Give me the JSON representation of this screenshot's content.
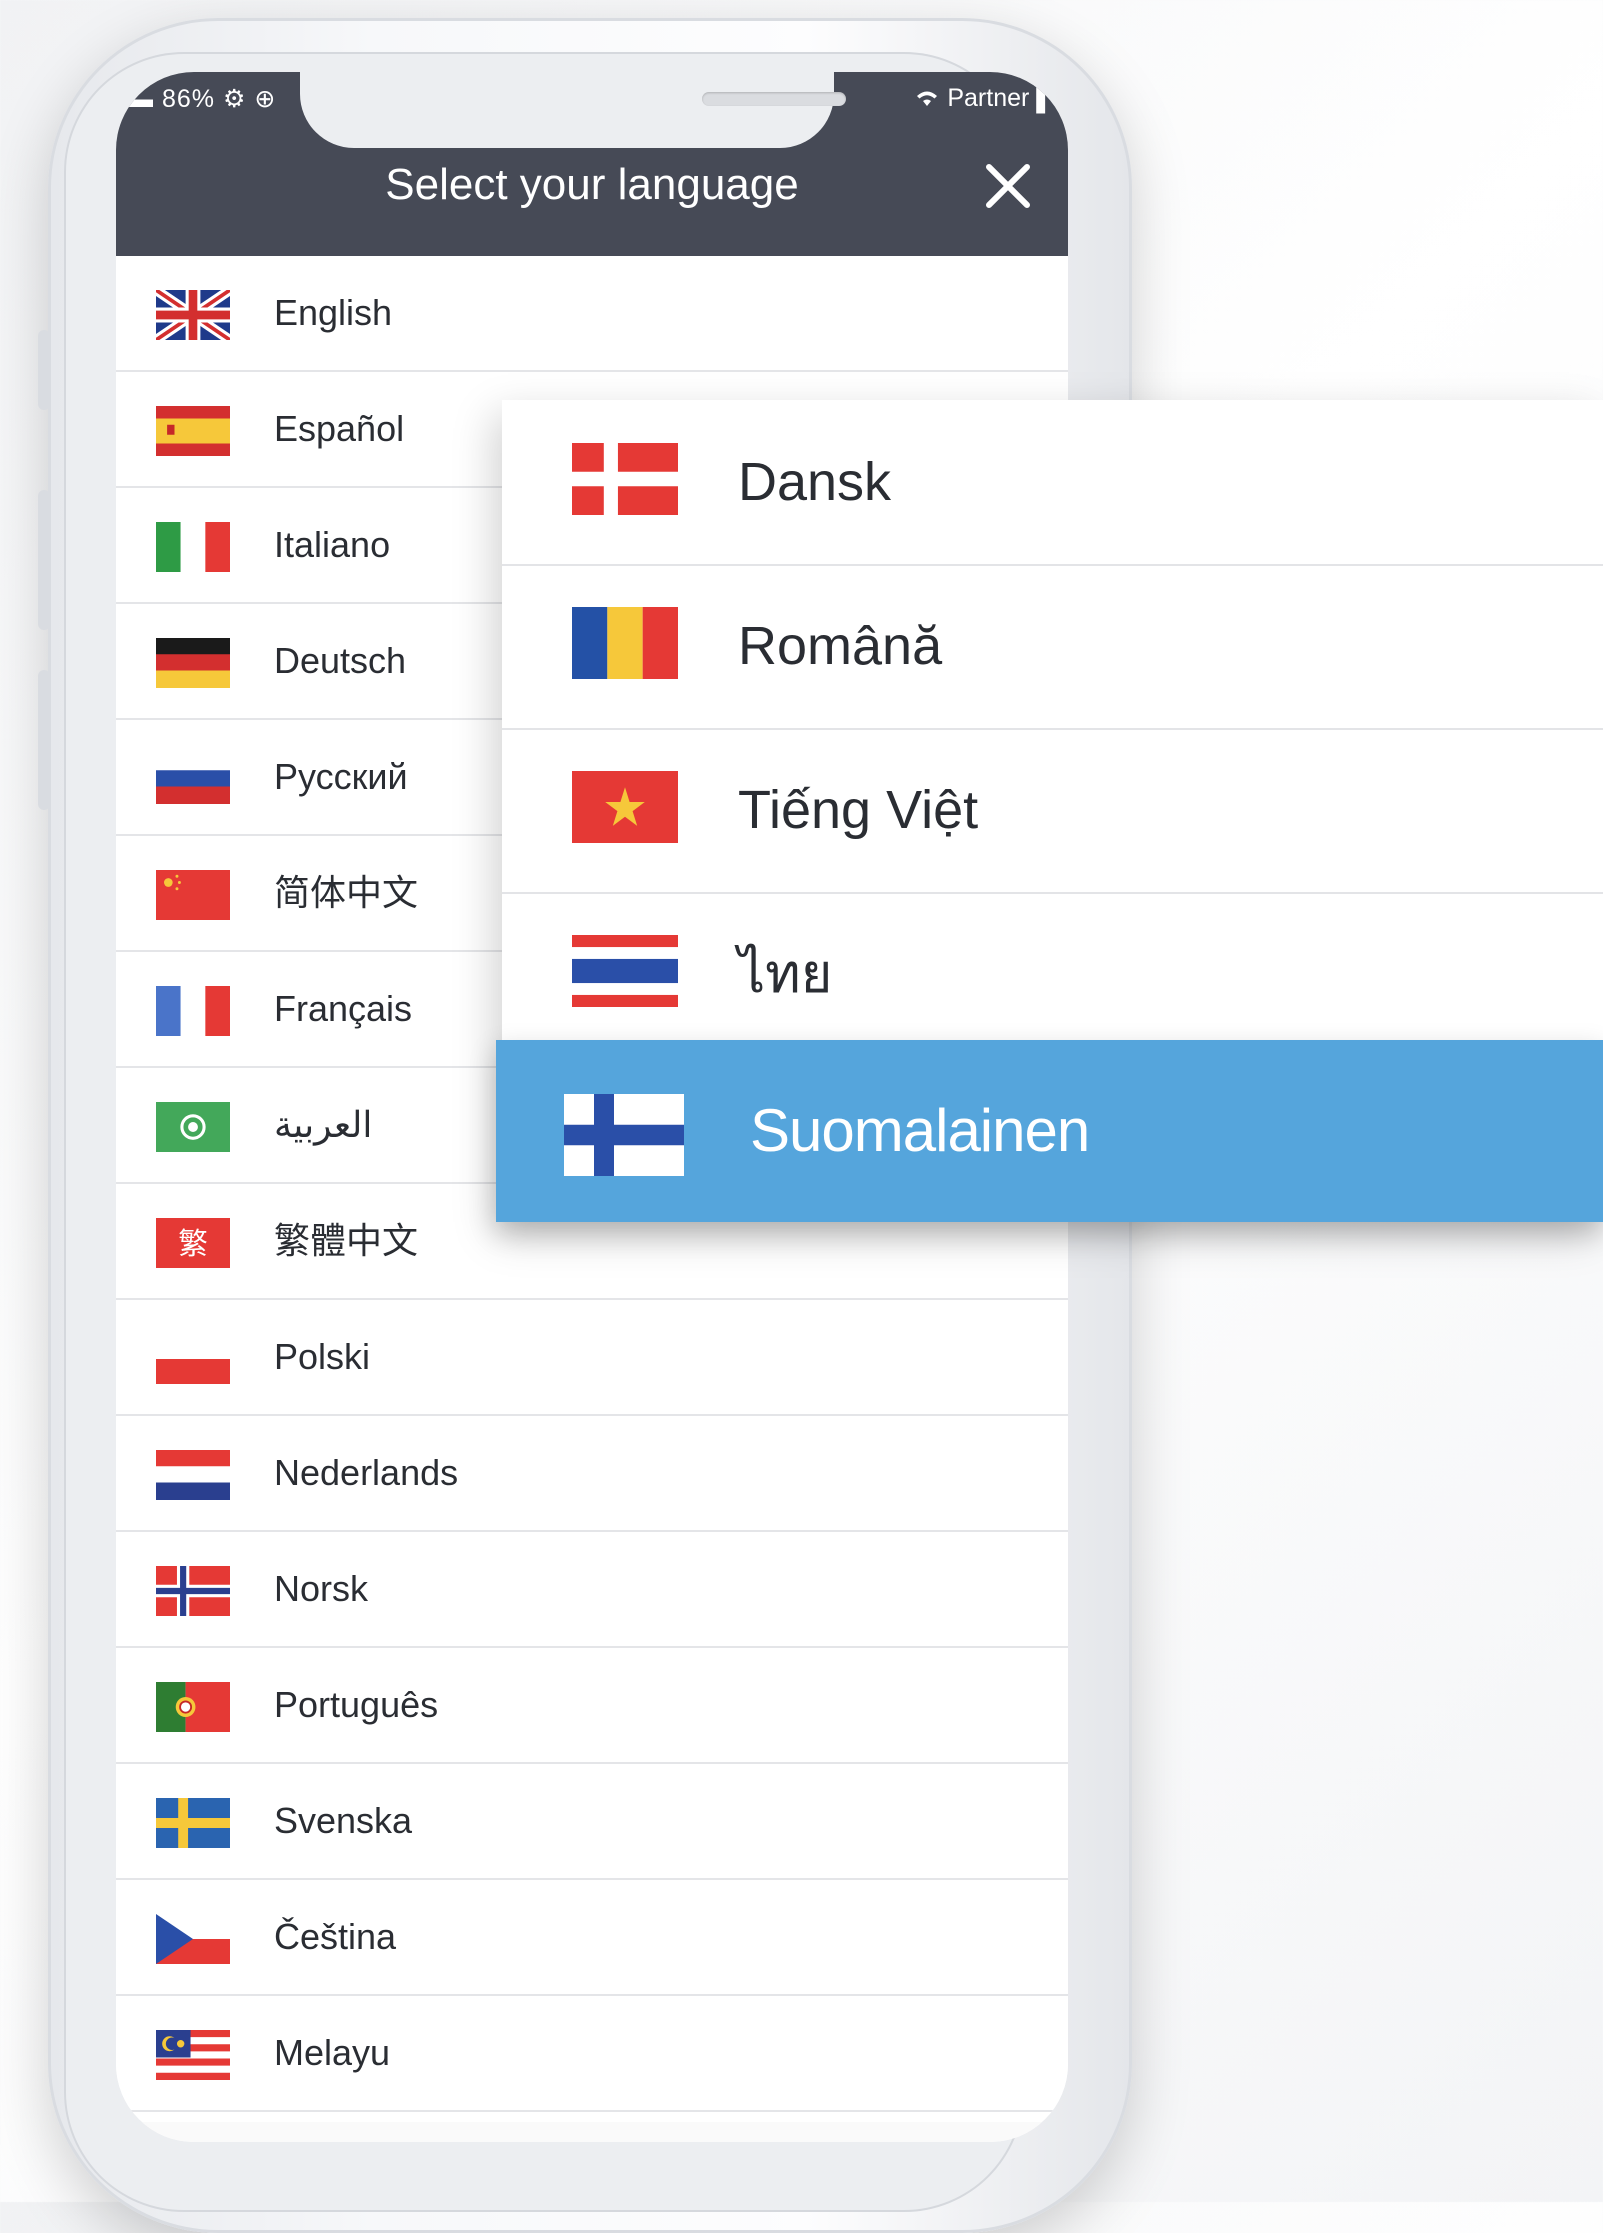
{
  "status_bar": {
    "battery": "86%",
    "carrier": "Partner"
  },
  "header": {
    "title": "Select your language",
    "close_label": "Close"
  },
  "languages": [
    {
      "label": "English",
      "flag": "uk-flag-icon"
    },
    {
      "label": "Español",
      "flag": "spain-flag-icon"
    },
    {
      "label": "Italiano",
      "flag": "italy-flag-icon"
    },
    {
      "label": "Deutsch",
      "flag": "germany-flag-icon"
    },
    {
      "label": "Русский",
      "flag": "russia-flag-icon"
    },
    {
      "label": "简体中文",
      "flag": "china-flag-icon"
    },
    {
      "label": "Français",
      "flag": "france-flag-icon"
    },
    {
      "label": "العربية",
      "flag": "arab-league-flag-icon"
    },
    {
      "label": "繁體中文",
      "flag": "traditional-chinese-flag-icon"
    },
    {
      "label": "Polski",
      "flag": "poland-flag-icon"
    },
    {
      "label": "Nederlands",
      "flag": "netherlands-flag-icon"
    },
    {
      "label": "Norsk",
      "flag": "norway-flag-icon"
    },
    {
      "label": "Português",
      "flag": "portugal-flag-icon"
    },
    {
      "label": "Svenska",
      "flag": "sweden-flag-icon"
    },
    {
      "label": "Čeština",
      "flag": "czech-flag-icon"
    },
    {
      "label": "Melayu",
      "flag": "malaysia-flag-icon"
    }
  ],
  "zoomed_languages": [
    {
      "label": "Dansk",
      "flag": "denmark-flag-icon",
      "selected": false
    },
    {
      "label": "Română",
      "flag": "romania-flag-icon",
      "selected": false
    },
    {
      "label": "Tiếng Việt",
      "flag": "vietnam-flag-icon",
      "selected": false
    },
    {
      "label": "ไทย",
      "flag": "thailand-flag-icon",
      "selected": false
    },
    {
      "label": "Suomalainen",
      "flag": "finland-flag-icon",
      "selected": true
    }
  ],
  "colors": {
    "header_bg": "#464a56",
    "selected_bg": "#55a5dc",
    "text": "#2a2d33"
  }
}
